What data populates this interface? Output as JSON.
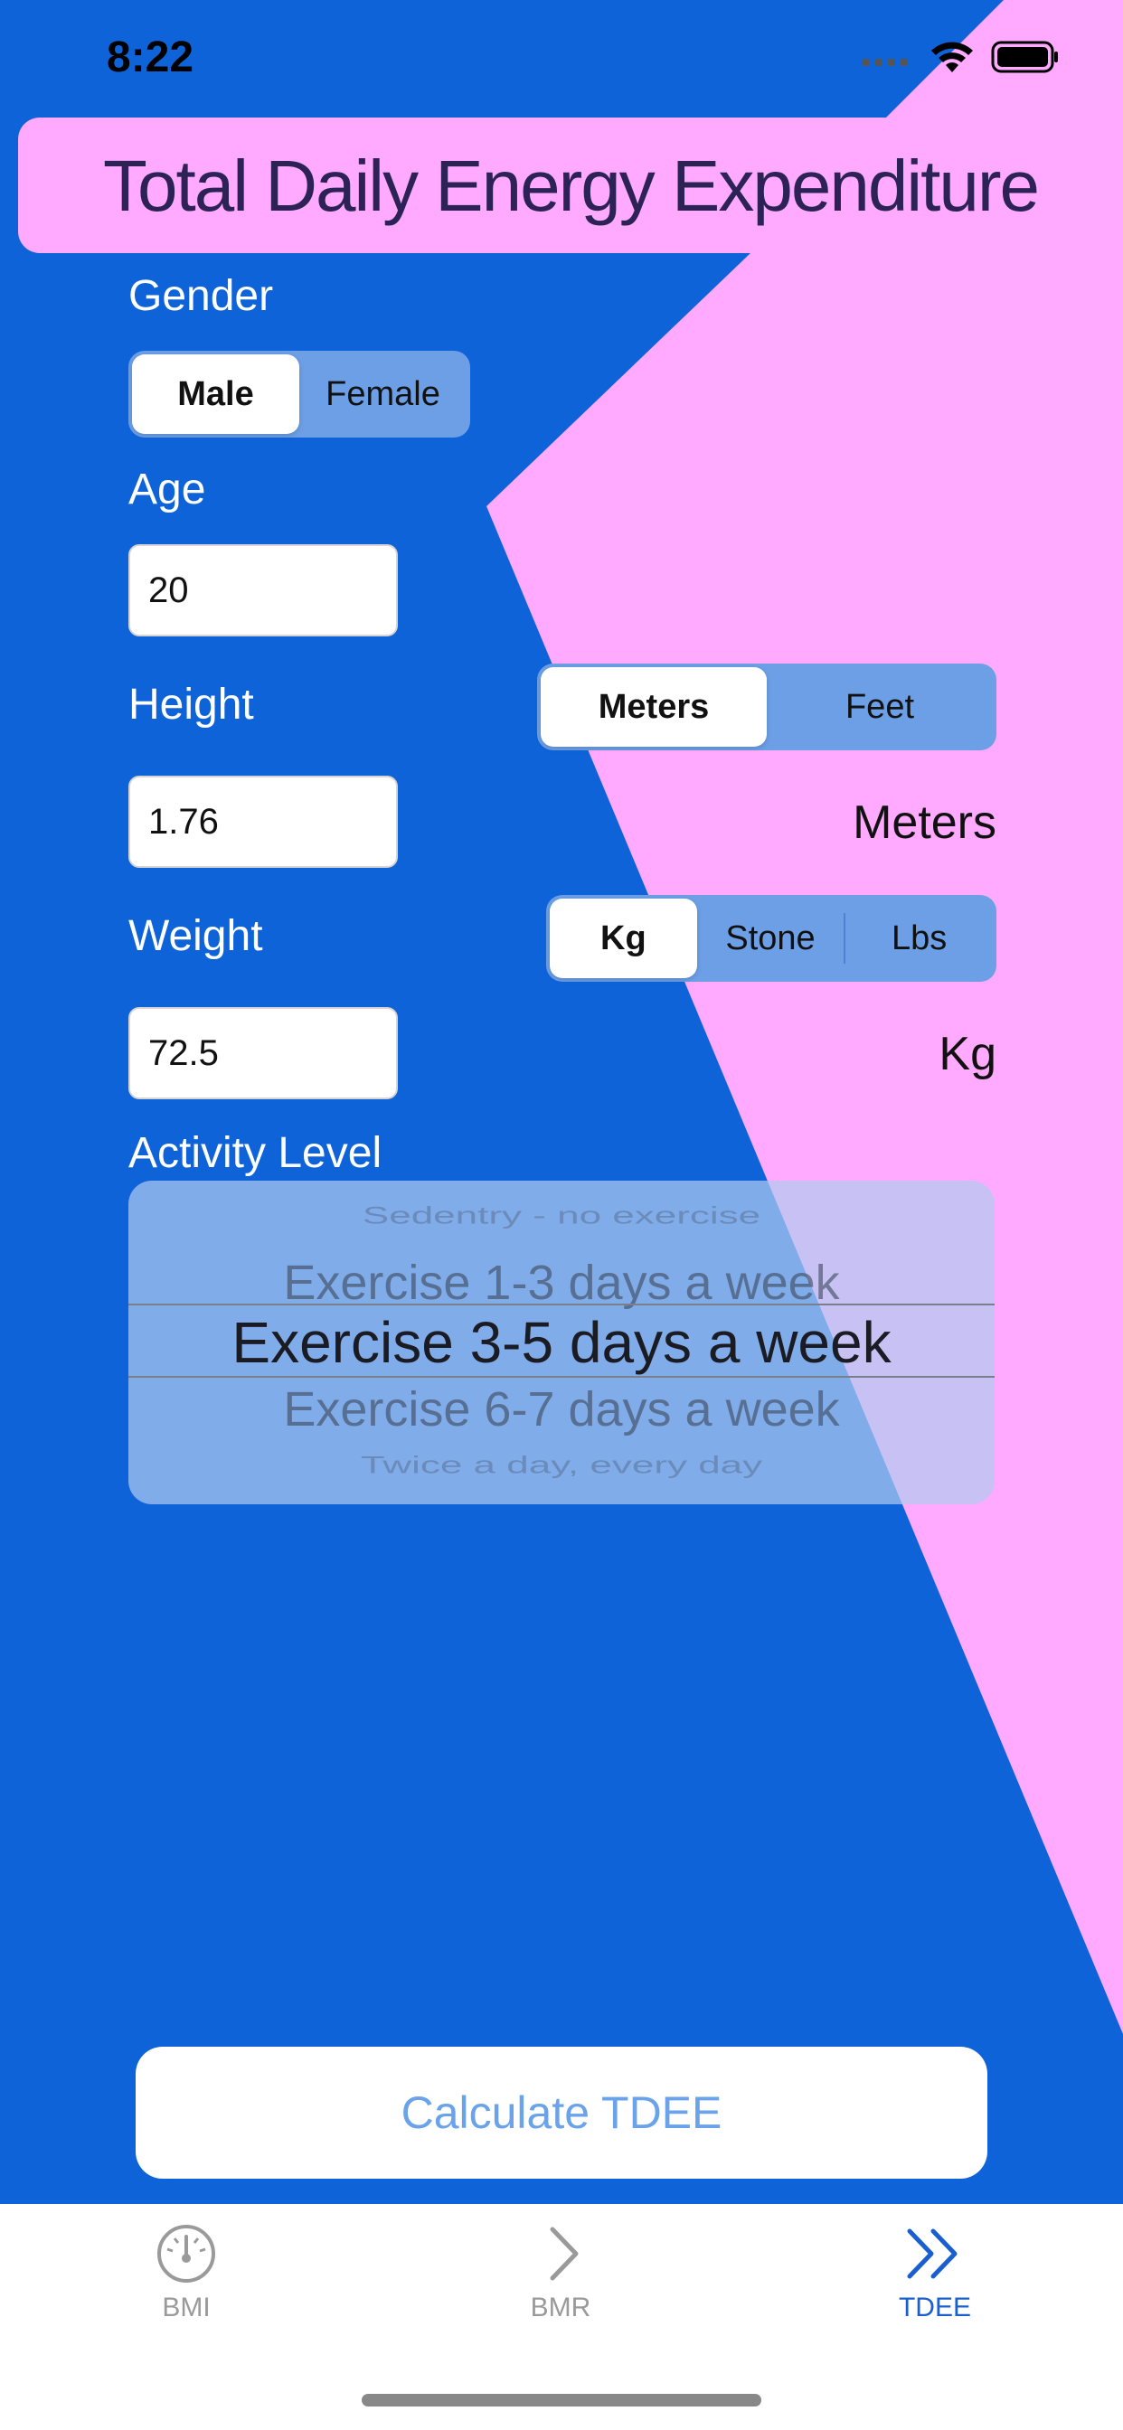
{
  "status_bar": {
    "time": "8:22"
  },
  "header": {
    "title": "Total Daily Energy Expenditure"
  },
  "gender": {
    "label": "Gender",
    "options": [
      "Male",
      "Female"
    ],
    "selected": "Male"
  },
  "age": {
    "label": "Age",
    "value": "20"
  },
  "height": {
    "label": "Height",
    "value": "1.76",
    "units": [
      "Meters",
      "Feet"
    ],
    "selected_unit": "Meters",
    "unit_display": "Meters"
  },
  "weight": {
    "label": "Weight",
    "value": "72.5",
    "units": [
      "Kg",
      "Stone",
      "Lbs"
    ],
    "selected_unit": "Kg",
    "unit_display": "Kg"
  },
  "activity": {
    "label": "Activity Level",
    "options": [
      "Sedentry - no exercise",
      "Exercise 1-3 days a week",
      "Exercise 3-5 days a week",
      "Exercise 6-7 days a week",
      "Twice a day, every day"
    ],
    "selected": "Exercise 3-5 days a week"
  },
  "calculate_button": {
    "label": "Calculate TDEE"
  },
  "tab_bar": {
    "tabs": [
      {
        "label": "BMI",
        "icon": "gauge-icon",
        "active": false
      },
      {
        "label": "BMR",
        "icon": "chevron-right-icon",
        "active": false
      },
      {
        "label": "TDEE",
        "icon": "double-chevron-right-icon",
        "active": true
      }
    ]
  },
  "colors": {
    "background": "#0f63d9",
    "accent_pink": "#ffaaff",
    "tab_active": "#1a5fd0",
    "tab_inactive": "#9a9a9a"
  }
}
